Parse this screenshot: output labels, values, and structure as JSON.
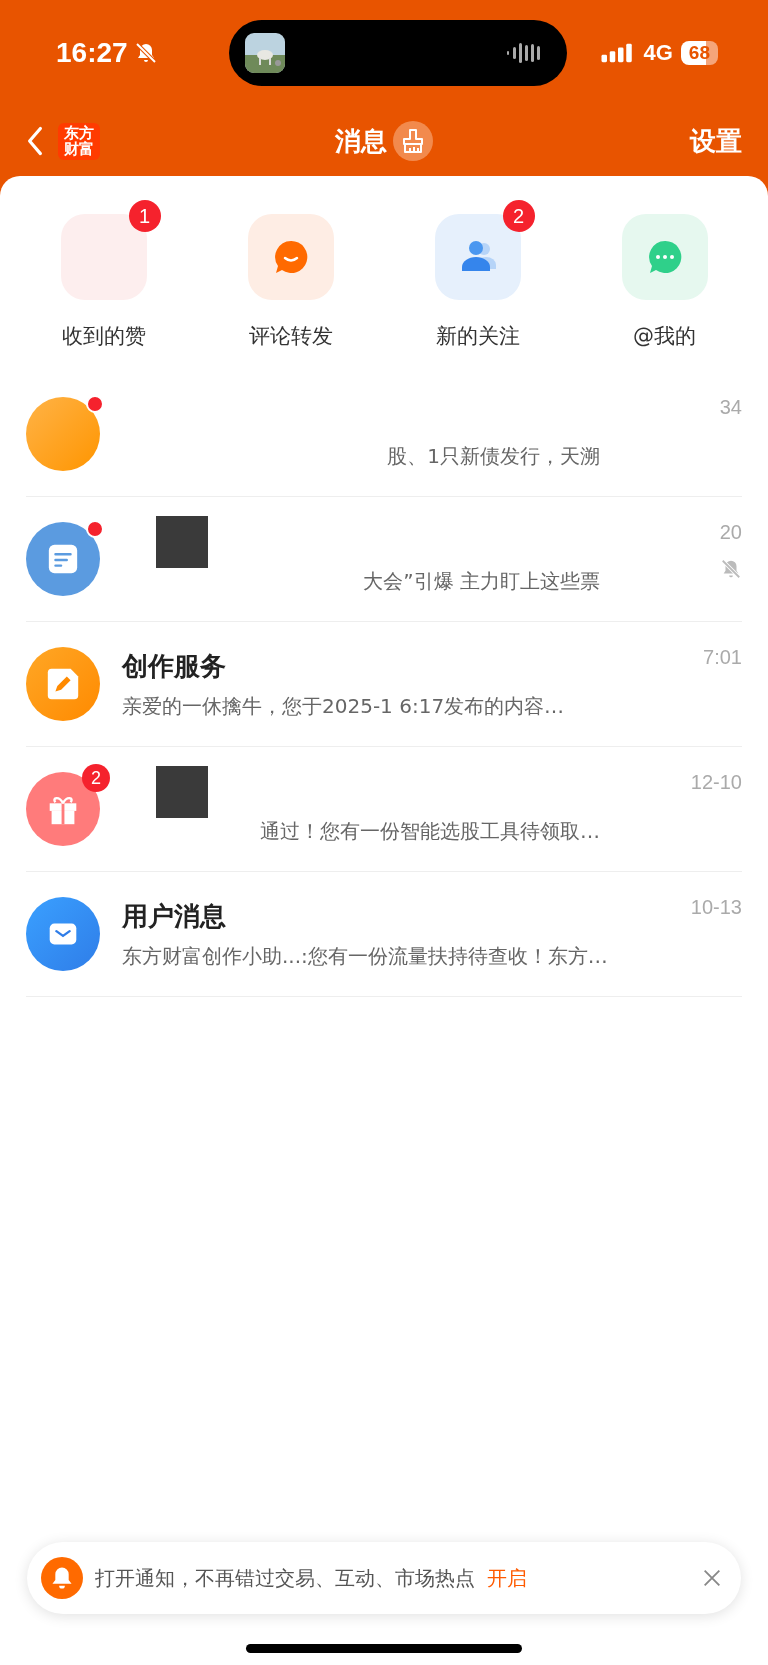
{
  "status_bar": {
    "time": "16:27",
    "network": "4G",
    "battery": "68"
  },
  "nav": {
    "logo": "东方财富",
    "title": "消息",
    "right": "设置"
  },
  "shortcuts": [
    {
      "kind": "like",
      "label": "收到的赞",
      "badge": "1"
    },
    {
      "kind": "comment",
      "label": "评论转发"
    },
    {
      "kind": "follow",
      "label": "新的关注",
      "badge": "2"
    },
    {
      "kind": "mention",
      "label": "@我的"
    }
  ],
  "messages": [
    {
      "kind": "blank",
      "dot": true,
      "redacted": false,
      "start_hidden": true,
      "preview": "股、1只新债发行，天溯",
      "time": "34",
      "muted": false
    },
    {
      "kind": "doc",
      "dot": true,
      "redacted": true,
      "start_hidden": true,
      "preview": "大会”引爆 主力盯上这些票",
      "time": "20",
      "muted": true
    },
    {
      "kind": "pencil",
      "dot": false,
      "redacted": false,
      "start_hidden": false,
      "title": "创作服务",
      "preview": "亲爱的一休擒牛，您于2025-1     6:17发布的内容…",
      "time": "7:01",
      "muted": false
    },
    {
      "kind": "gift",
      "dot": false,
      "badge": "2",
      "redacted": true,
      "start_hidden": true,
      "preview": "通过！您有一份智能选股工具待领取…",
      "time": "12-10",
      "muted": false
    },
    {
      "kind": "mail",
      "dot": false,
      "redacted": false,
      "start_hidden": false,
      "title": "用户消息",
      "preview": "东方财富创作小助...:您有一份流量扶持待查收！东方…",
      "time": "10-13",
      "muted": false
    }
  ],
  "banner": {
    "text": "打开通知，不再错过交易、互动、市场热点",
    "action": "开启"
  }
}
